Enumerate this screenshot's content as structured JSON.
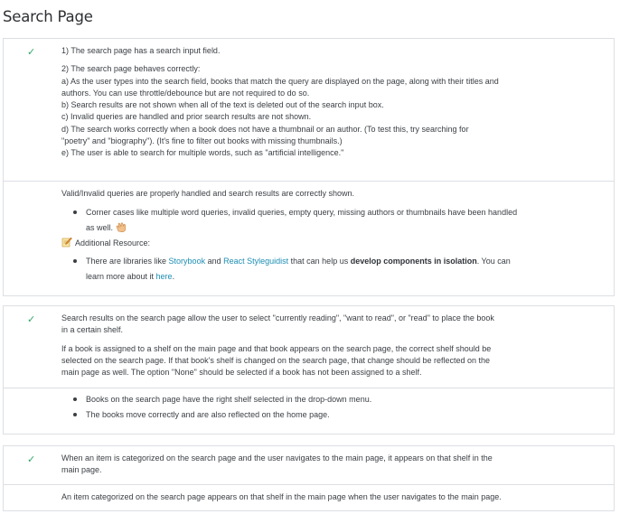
{
  "page_title": "Search Page",
  "icons": {
    "check": "check-icon",
    "clap": "clapping-hands-icon",
    "memo": "memo-icon"
  },
  "colors": {
    "check": "#2fa76b",
    "link": "#1d8eb3",
    "border": "#dcdfe3"
  },
  "criteria": [
    {
      "spec": {
        "line1": "1) The search page has a search input field.",
        "line2": "2) The search page behaves correctly:",
        "line3": "a) As the user types into the search field, books that match the query are displayed on the page, along with their titles and",
        "line4": "authors. You can use throttle/debounce but are not required to do so.",
        "line5": "b) Search results are not shown when all of the text is deleted out of the search input box.",
        "line6": "c) Invalid queries are handled and prior search results are not shown.",
        "line7": "d) The search works correctly when a book does not have a thumbnail or an author. (To test this, try searching for",
        "line8": "\"poetry\" and \"biography\"). (It's fine to filter out books with missing thumbnails.)",
        "line9": "e) The user is able to search for multiple words, such as \"artificial intelligence.\""
      },
      "review": {
        "summary": "Valid/Invalid queries are properly handled and search results are correctly shown.",
        "bullet1_line1": "Corner cases like multiple word queries, invalid queries, empty query, missing authors or thumbnails have been handled",
        "bullet1_line2": "as well.",
        "resource_heading": "Additional Resource:",
        "bullet2_pre": "There are libraries like ",
        "link_storybook": "Storybook",
        "and_text": " and ",
        "link_styleguidist": "React Styleguidist",
        "bullet2_mid": " that can help us ",
        "bullet2_bold": "develop components in isolation",
        "bullet2_end": ". You can",
        "bullet2_line2_pre": "learn more about it ",
        "link_here": "here",
        "period": "."
      }
    },
    {
      "spec": {
        "line1": "Search results on the search page allow the user to select \"currently reading\", \"want to read\", or \"read\" to place the book",
        "line2": "in a certain shelf.",
        "line3": "If a book is assigned to a shelf on the main page and that book appears on the search page, the correct shelf should be",
        "line4": "selected on the search page. If that book's shelf is changed on the search page, that change should be reflected on the",
        "line5": "main page as well. The option \"None\" should be selected if a book has not been assigned to a shelf."
      },
      "review": {
        "bullet1": "Books on the search page have the right shelf selected in the drop-down menu.",
        "bullet2": "The books move correctly and are also reflected on the home page."
      }
    },
    {
      "spec": {
        "line1": "When an item is categorized on the search page and the user navigates to the main page, it appears on that shelf in the",
        "line2": "main page."
      },
      "review": {
        "summary": "An item categorized on the search page appears on that shelf in the main page when the user navigates to the main page."
      }
    }
  ]
}
